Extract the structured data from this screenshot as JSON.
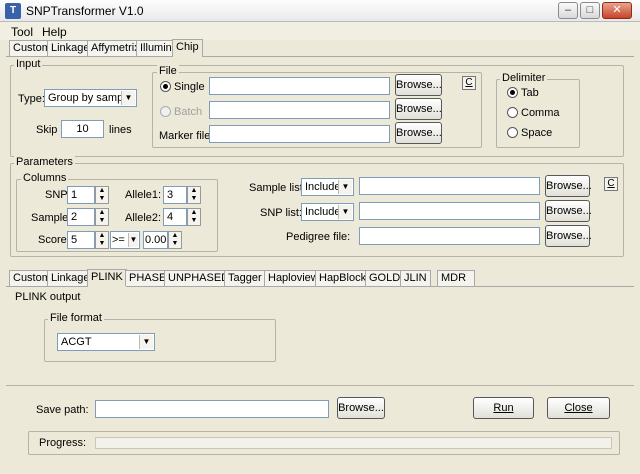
{
  "window": {
    "title": "SNPTransformer V1.0",
    "minimize": "–",
    "maximize": "□",
    "close": "✕"
  },
  "menu": [
    "Tool",
    "Help"
  ],
  "input_tabs": [
    "Custom",
    "Linkage",
    "Affymetrix",
    "Illumina",
    "Chip"
  ],
  "input": {
    "legend": "Input",
    "type_label": "Type:",
    "type_value": "Group by sample",
    "skip_label": "Skip",
    "skip_value": "10",
    "lines_label": "lines",
    "file": {
      "legend": "File",
      "single_label": "Single",
      "batch_label": "Batch",
      "marker_label": "Marker file:",
      "browse": "Browse...",
      "c_button": "C"
    },
    "delimiter": {
      "legend": "Delimiter",
      "options": [
        "Tab",
        "Comma",
        "Space"
      ]
    }
  },
  "parameters": {
    "legend": "Parameters",
    "columns_legend": "Columns",
    "snp_label": "SNP:",
    "snp_value": "1",
    "sample_label": "Sample:",
    "sample_value": "2",
    "score_label": "Score:",
    "score_value": "5",
    "score_op": ">=",
    "score_threshold": "0.00",
    "allele1_label": "Allele1:",
    "allele1_value": "3",
    "allele2_label": "Allele2:",
    "allele2_value": "4",
    "sample_list_label": "Sample list:",
    "snp_list_label": "SNP list:",
    "pedigree_label": "Pedigree file:",
    "include": "Include",
    "browse": "Browse...",
    "c_button": "C"
  },
  "output_tabs": [
    "Custom",
    "Linkage",
    "PLINK",
    "PHASE",
    "UNPHASED",
    "Tagger",
    "Haploview",
    "HapBlock",
    "GOLD",
    "JLIN",
    "MDR"
  ],
  "output": {
    "legend": "PLINK output",
    "format_legend": "File format",
    "format_value": "ACGT"
  },
  "bottom": {
    "save_label": "Save path:",
    "browse": "Browse...",
    "run": "Run",
    "close": "Close",
    "progress_label": "Progress:",
    "progress": 0
  }
}
